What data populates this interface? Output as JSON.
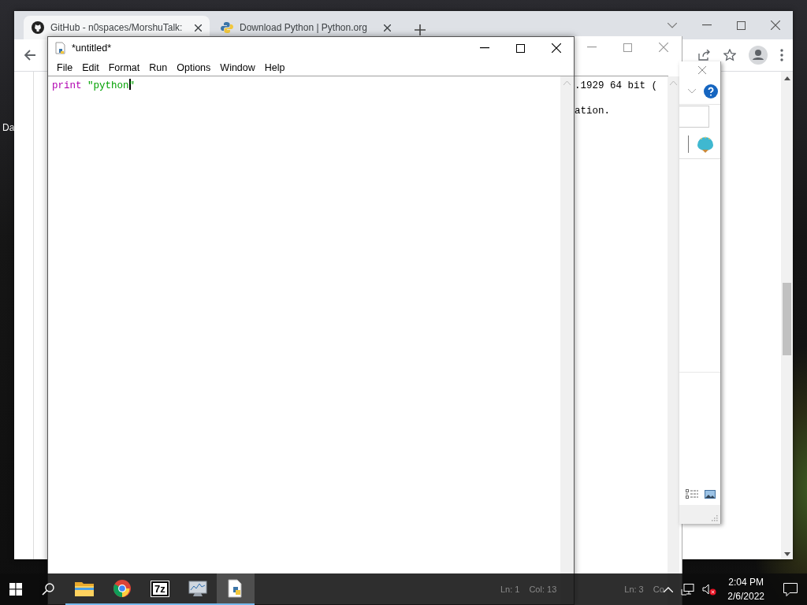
{
  "desktop": {
    "icon_label": "Da"
  },
  "browser": {
    "tabs": [
      {
        "label": "GitHub - n0spaces/MorshuTalk:",
        "selected": true
      },
      {
        "label": "Download Python | Python.org",
        "selected": false
      }
    ]
  },
  "shell_window": {
    "lines": [
      ".1929 64 bit (",
      "ation."
    ],
    "status": [
      "Ln: 3",
      "Co"
    ]
  },
  "editor": {
    "title": "*untitled*",
    "menu": [
      "File",
      "Edit",
      "Format",
      "Run",
      "Options",
      "Window",
      "Help"
    ],
    "code": [
      {
        "kind": "keyword",
        "text": "print"
      },
      {
        "kind": "string",
        "text": " \"python"
      },
      {
        "kind": "cursor"
      },
      {
        "kind": "string",
        "text": "\""
      }
    ],
    "status": [
      "Ln: 1",
      "Col: 13"
    ]
  },
  "taskbar": {
    "apps": [
      {
        "kind": "folder",
        "selected": false
      },
      {
        "kind": "chrome",
        "selected": false
      },
      {
        "kind": "archiver",
        "label": "7z",
        "selected": false
      },
      {
        "kind": "monitor",
        "selected": false
      },
      {
        "kind": "idle",
        "selected": true
      }
    ],
    "time": "2:04 PM",
    "date": "2/6/2022"
  }
}
